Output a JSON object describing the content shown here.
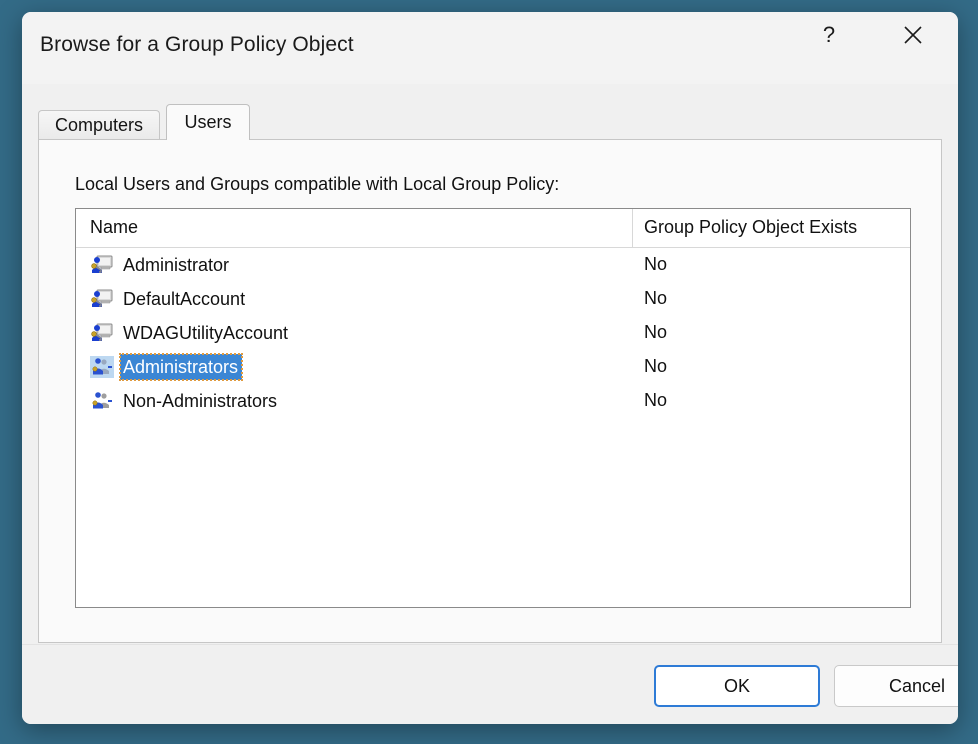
{
  "window": {
    "title": "Browse for a Group Policy Object",
    "help_button": "?",
    "help_icon": "question-mark-icon",
    "close_icon": "close-x-icon"
  },
  "tabs": [
    {
      "label": "Computers",
      "active": false
    },
    {
      "label": "Users",
      "active": true
    }
  ],
  "panel": {
    "label": "Local Users and Groups compatible with Local Group Policy:"
  },
  "list": {
    "columns": [
      "Name",
      "Group Policy Object Exists"
    ],
    "rows": [
      {
        "name": "Administrator",
        "gpo": "No",
        "icon": "user-icon",
        "selected": false
      },
      {
        "name": "DefaultAccount",
        "gpo": "No",
        "icon": "user-icon",
        "selected": false
      },
      {
        "name": "WDAGUtilityAccount",
        "gpo": "No",
        "icon": "user-icon",
        "selected": false
      },
      {
        "name": "Administrators",
        "gpo": "No",
        "icon": "group-icon",
        "selected": true
      },
      {
        "name": "Non-Administrators",
        "gpo": "No",
        "icon": "group-icon",
        "selected": false
      }
    ]
  },
  "footer": {
    "ok_label": "OK",
    "cancel_label": "Cancel"
  },
  "colors": {
    "desktop": "#336b87",
    "dialog": "#f0f0f0",
    "selection": "#3b86d4",
    "focus_outline": "#e09a3e",
    "default_button_border": "#2e7bd6"
  }
}
